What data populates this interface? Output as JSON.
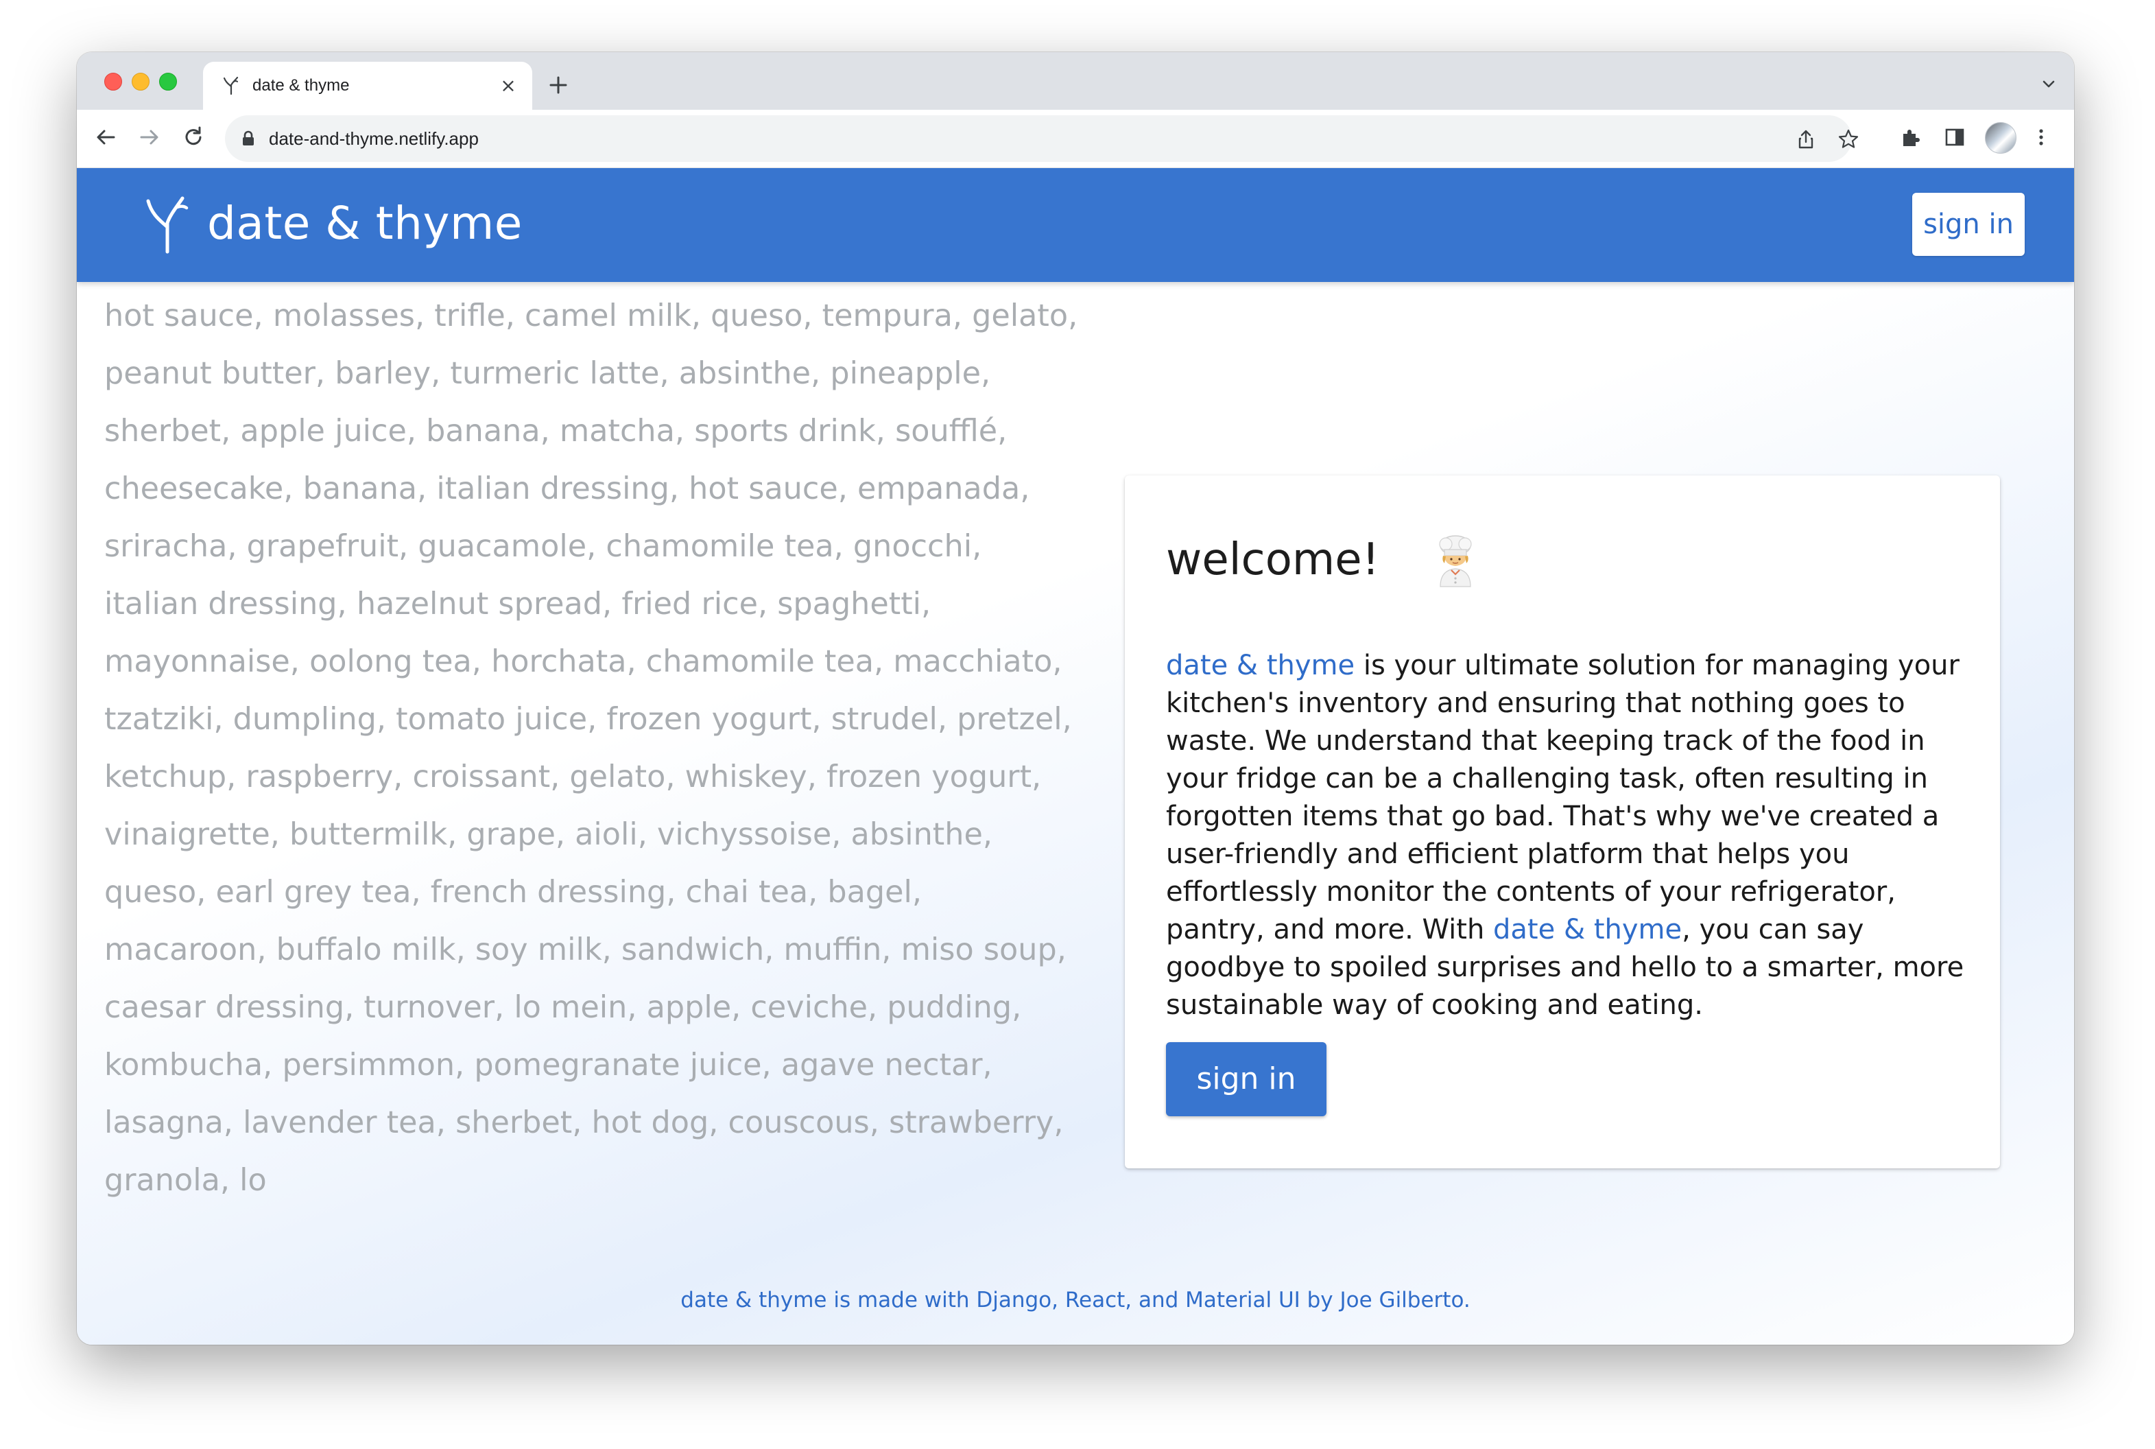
{
  "browser": {
    "tab": {
      "title": "date & thyme",
      "favicon": "sprout-icon"
    },
    "url": "date-and-thyme.netlify.app",
    "icons": [
      "back-icon",
      "forward-icon",
      "reload-icon",
      "lock-icon",
      "share-icon",
      "star-icon",
      "extensions-icon",
      "side-panel-icon",
      "profile-avatar",
      "menu-icon",
      "new-tab-icon",
      "tab-search-icon",
      "close-icon"
    ]
  },
  "app": {
    "brand": "date & thyme",
    "brand_icon": "sprout-icon",
    "header_signin_label": "sign in",
    "primary_color": "#3875cf",
    "word_wall": "hot sauce, molasses, trifle, camel milk, queso, tempura, gelato, peanut butter, barley, turmeric latte, absinthe, pineapple, sherbet, apple juice, banana, matcha, sports drink, soufflé, cheesecake, banana, italian dressing, hot sauce, empanada, sriracha, grapefruit, guacamole, chamomile tea, gnocchi, italian dressing, hazelnut spread, fried rice, spaghetti, mayonnaise, oolong tea, horchata, chamomile tea, macchiato, tzatziki, dumpling, tomato juice, frozen yogurt, strudel, pretzel, ketchup, raspberry, croissant, gelato, whiskey, frozen yogurt, vinaigrette, buttermilk, grape, aioli, vichyssoise, absinthe, queso, earl grey tea, french dressing, chai tea, bagel, macaroon, buffalo milk, soy milk, sandwich, muffin, miso soup, caesar dressing, turnover, lo mein, apple, ceviche, pudding, kombucha, persimmon, pomegranate juice, agave nectar, lasagna, lavender tea, sherbet, hot dog, couscous, strawberry, granola, lo",
    "card": {
      "title": "welcome!",
      "title_icon": "chef-emoji",
      "body": {
        "link1": "date & thyme",
        "part1": " is your ultimate solution for managing your kitchen's inventory and ensuring that nothing goes to waste. We understand that keeping track of the food in your fridge can be a challenging task, often resulting in forgotten items that go bad. That's why we've created a user-friendly and efficient platform that helps you effortlessly monitor the contents of your refrigerator, pantry, and more. With ",
        "link2": "date & thyme",
        "part2": ", you can say goodbye to spoiled surprises and hello to a smarter, more sustainable way of cooking and eating."
      },
      "signin_label": "sign in"
    },
    "footer": "date & thyme is made with Django, React, and Material UI by Joe Gilberto."
  }
}
